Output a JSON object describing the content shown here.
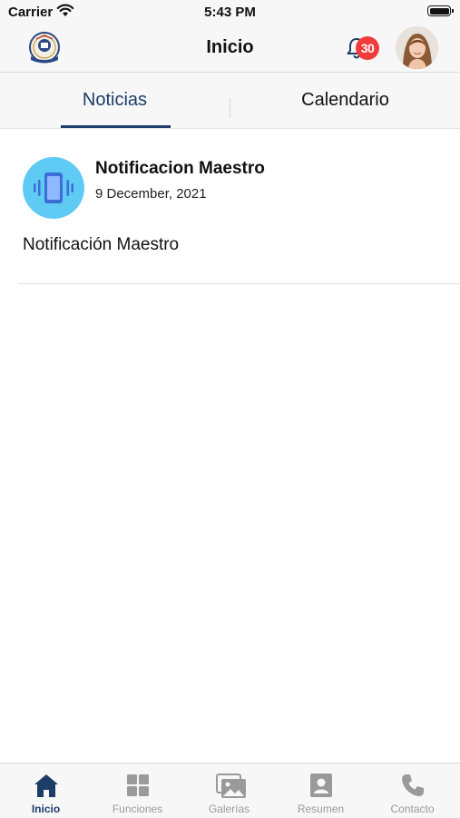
{
  "status_bar": {
    "carrier": "Carrier",
    "time": "5:43 PM"
  },
  "nav": {
    "title": "Inicio",
    "notification_count": "30"
  },
  "tabs": [
    {
      "label": "Noticias",
      "active": true
    },
    {
      "label": "Calendario",
      "active": false
    }
  ],
  "news": [
    {
      "title": "Notificacion Maestro",
      "date": "9 December, 2021",
      "body": "Notificación Maestro",
      "icon": "phone-vibrate-icon"
    }
  ],
  "bottom_nav": [
    {
      "label": "Inicio",
      "icon": "home-icon",
      "active": true
    },
    {
      "label": "Funciones",
      "icon": "grid-icon",
      "active": false
    },
    {
      "label": "Galerías",
      "icon": "gallery-icon",
      "active": false
    },
    {
      "label": "Resumen",
      "icon": "profile-card-icon",
      "active": false
    },
    {
      "label": "Contacto",
      "icon": "phone-icon",
      "active": false
    }
  ],
  "colors": {
    "accent": "#1d3d68",
    "badge": "#f23b3b",
    "news_icon_bg": "#5fcaf4",
    "inactive": "#9a9a9a"
  }
}
